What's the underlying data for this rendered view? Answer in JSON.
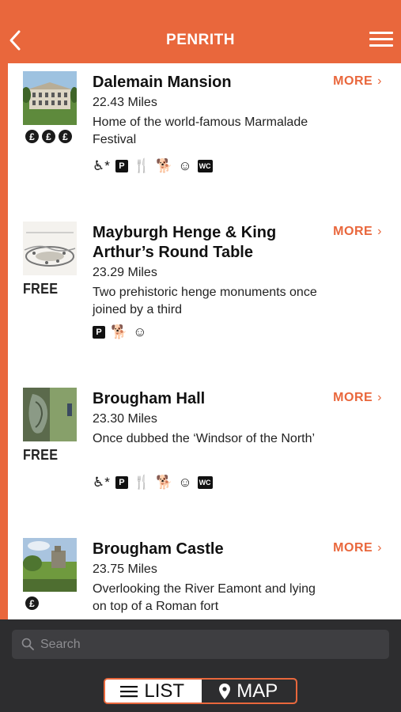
{
  "header": {
    "title": "PENRITH"
  },
  "items": [
    {
      "name": "Dalemain Mansion",
      "distance": "22.43 Miles",
      "description": "Home of the world-famous Marmalade Festival",
      "more_label": "MORE",
      "price_coins": 3,
      "price_text": "",
      "amenities": [
        "wheelchair-accessible",
        "parking",
        "restaurant",
        "dogs-allowed",
        "family-friendly",
        "toilets"
      ]
    },
    {
      "name": "Mayburgh Henge & King Arthur’s Round Table",
      "distance": "23.29 Miles",
      "description": "Two prehistoric henge monuments once joined by a third",
      "more_label": "MORE",
      "price_coins": 0,
      "price_text": "FREE",
      "amenities": [
        "parking",
        "dogs-allowed",
        "family-friendly"
      ]
    },
    {
      "name": "Brougham Hall",
      "distance": "23.30 Miles",
      "description": "Once dubbed the ‘Windsor of the North’",
      "more_label": "MORE",
      "price_coins": 0,
      "price_text": "FREE",
      "amenities": [
        "wheelchair-accessible",
        "parking",
        "restaurant",
        "dogs-allowed",
        "family-friendly",
        "toilets"
      ]
    },
    {
      "name": "Brougham Castle",
      "distance": "23.75 Miles",
      "description": "Overlooking the River Eamont and lying on top of a Roman fort",
      "more_label": "MORE",
      "price_coins": 1,
      "price_text": "",
      "amenities": []
    }
  ],
  "search": {
    "placeholder": "Search"
  },
  "view_toggle": {
    "list_label": "LIST",
    "map_label": "MAP",
    "selected": "LIST"
  },
  "colors": {
    "accent": "#e9673c",
    "footer": "#2d2d2f"
  }
}
